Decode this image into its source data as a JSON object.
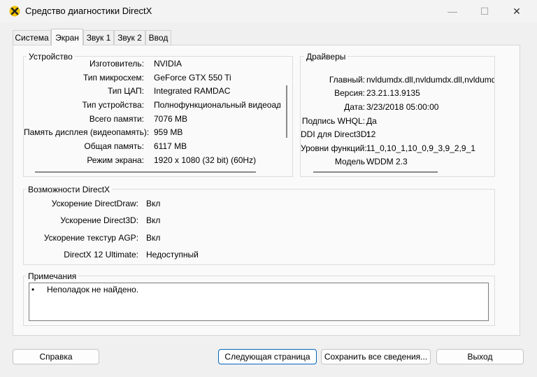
{
  "window": {
    "title": "Средство диагностики DirectX",
    "minimize_glyph": "—",
    "maximize_glyph": "☐",
    "close_glyph": "✕"
  },
  "tabs": [
    {
      "label": "Система"
    },
    {
      "label": "Экран"
    },
    {
      "label": "Звук 1"
    },
    {
      "label": "Звук 2"
    },
    {
      "label": "Ввод"
    }
  ],
  "device": {
    "legend": "Устройство",
    "rows": [
      {
        "label": "Изготовитель:",
        "value": "NVIDIA"
      },
      {
        "label": "Тип микросхем:",
        "value": "GeForce GTX 550 Ti"
      },
      {
        "label": "Тип ЦАП:",
        "value": "Integrated RAMDAC"
      },
      {
        "label": "Тип устройства:",
        "value": "Полнофункциональный видеоадаптер"
      },
      {
        "label": "Всего памяти:",
        "value": "7076 MB"
      },
      {
        "label": "Память дисплея (видеопамять):",
        "value": "959 MB"
      },
      {
        "label": "Общая память:",
        "value": "6117 MB"
      },
      {
        "label": "Режим экрана:",
        "value": "1920 x 1080 (32 bit) (60Hz)"
      }
    ]
  },
  "drivers": {
    "legend": "Драйверы",
    "rows": [
      {
        "label": "Главный:",
        "value": "nvldumdx.dll,nvldumdx.dll,nvldumdx.dll,nvldumdx.dll"
      },
      {
        "label": "Версия:",
        "value": "23.21.13.9135"
      },
      {
        "label": "Дата:",
        "value": "3/23/2018 05:00:00"
      },
      {
        "label": "Подпись WHQL:",
        "value": "Да"
      },
      {
        "label": "DDI для Direct3D:",
        "value": "12"
      },
      {
        "label": "Уровни функций:",
        "value": "11_0,10_1,10_0,9_3,9_2,9_1"
      },
      {
        "label": "Модель",
        "value": "WDDM 2.3"
      }
    ]
  },
  "features": {
    "legend": "Возможности DirectX",
    "rows": [
      {
        "label": "Ускорение DirectDraw:",
        "value": "Вкл"
      },
      {
        "label": "Ускорение Direct3D:",
        "value": "Вкл"
      },
      {
        "label": "Ускорение текстур AGP:",
        "value": "Вкл"
      },
      {
        "label": "DirectX 12 Ultimate:",
        "value": "Недоступный"
      }
    ]
  },
  "notes": {
    "legend": "Примечания",
    "bullet": "•",
    "text": "Неполадок не найдено."
  },
  "buttons": {
    "help": "Справка",
    "next_page": "Следующая страница",
    "save_all": "Сохранить все сведения...",
    "exit": "Выход"
  },
  "colors": {
    "accent": "#0067c0",
    "icon_yellow": "#f2c200"
  }
}
